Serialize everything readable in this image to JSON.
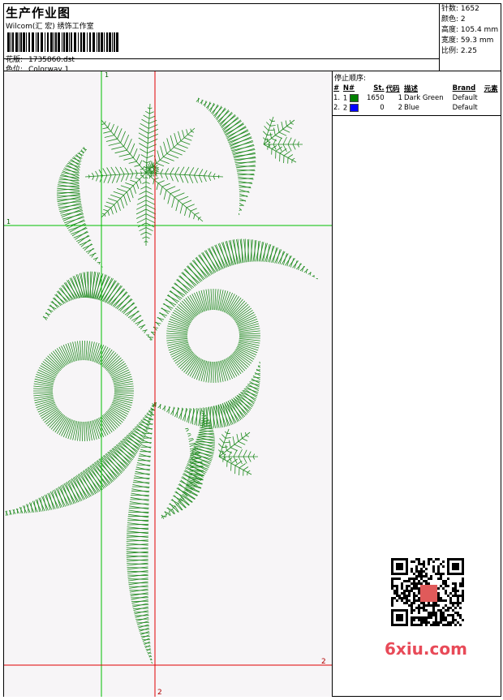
{
  "header": {
    "title": "生产作业图",
    "company": "Wilcom(汇 宏) 绣饰工作室",
    "design_label": "花版:",
    "design_file": "1735860.dst",
    "color_label": "色位:",
    "colorway": "Colorway 1"
  },
  "stats": [
    {
      "label": "针数:",
      "value": "1652"
    },
    {
      "label": "颜色:",
      "value": "2"
    },
    {
      "label": "高度:",
      "value": "105.4 mm"
    },
    {
      "label": "宽度:",
      "value": "59.3 mm"
    },
    {
      "label": "比例:",
      "value": "2.25"
    }
  ],
  "sequence": {
    "title": "停止顺序:",
    "columns": [
      "#",
      "N#",
      "St.",
      "代码",
      "描述",
      "Brand",
      "元素"
    ],
    "rows": [
      {
        "num": "1.",
        "n": "1",
        "color": "#008000",
        "stitches": "1650",
        "code": "1",
        "desc": "Dark Green",
        "brand": "Default"
      },
      {
        "num": "2.",
        "n": "2",
        "color": "#0000ff",
        "stitches": "0",
        "code": "2",
        "desc": "Blue",
        "brand": "Default"
      }
    ]
  },
  "guides": {
    "top_marker": "1",
    "left_marker": "1",
    "bottom_right_marker": "2",
    "bottom_marker": "2"
  },
  "embroidery_color": "#1e8a1e",
  "watermark": "6xiu.com"
}
